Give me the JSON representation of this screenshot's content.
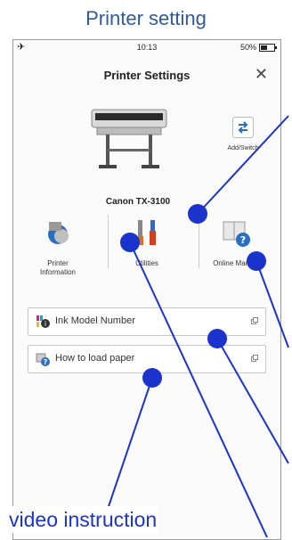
{
  "caption": "Printer setting",
  "status": {
    "time": "10:13",
    "battery": "50%"
  },
  "header": {
    "title": "Printer Settings"
  },
  "printer": {
    "name": "Canon TX-3100"
  },
  "switch": {
    "label": "Add/Switch"
  },
  "menu": {
    "printer_info_line1": "Printer",
    "printer_info_line2": "Information",
    "utilities": "Utilities",
    "online_manual": "Online Manual"
  },
  "list": {
    "ink_model": "Ink Model Number",
    "load_paper": "How to load paper"
  },
  "annotation": {
    "text": "video instruction"
  },
  "icons": {
    "airplane": "airplane-icon",
    "close": "close-icon",
    "switch": "switch-arrows-icon",
    "printer_info": "printer-info-icon",
    "utilities": "utilities-tools-icon",
    "manual": "manual-book-icon",
    "ink": "ink-info-icon",
    "paper": "paper-load-icon",
    "external": "external-link-icon"
  },
  "colors": {
    "annotation": "#1a33cc",
    "caption": "#2e5b9a",
    "accent": "#2a6ec2"
  }
}
